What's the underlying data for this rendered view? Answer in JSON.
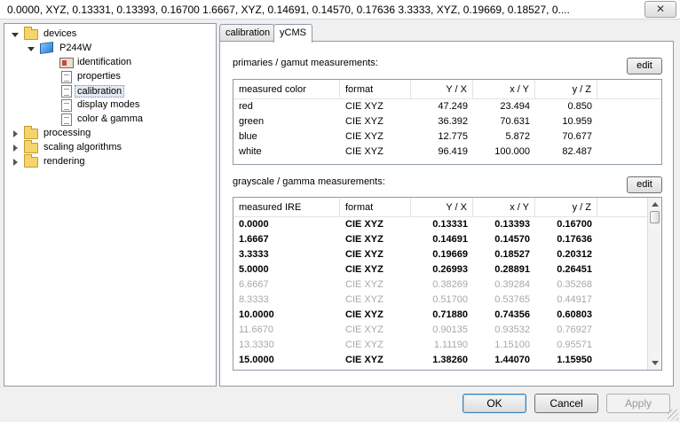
{
  "window": {
    "title": "0.0000, XYZ,  0.13331,    0.13393,  0.16700  1.6667, XYZ,  0.14691,    0.14570,  0.17636  3.3333, XYZ,  0.19669,   0.18527,  0....",
    "close_glyph": "✕"
  },
  "tree": {
    "items": [
      {
        "label": "devices",
        "icon": "folder-icon",
        "expanded": true
      },
      {
        "label": "P244W",
        "icon": "monitor-icon",
        "expanded": true
      },
      {
        "label": "identification",
        "icon": "id-card-icon"
      },
      {
        "label": "properties",
        "icon": "document-icon"
      },
      {
        "label": "calibration",
        "icon": "document-icon",
        "selected": true
      },
      {
        "label": "display modes",
        "icon": "document-icon"
      },
      {
        "label": "color & gamma",
        "icon": "document-icon"
      },
      {
        "label": "processing",
        "icon": "folder-icon",
        "expanded": false
      },
      {
        "label": "scaling algorithms",
        "icon": "folder-icon",
        "expanded": false
      },
      {
        "label": "rendering",
        "icon": "folder-icon",
        "expanded": false
      }
    ]
  },
  "tabs": [
    {
      "label": "calibration",
      "active": false
    },
    {
      "label": "yCMS",
      "active": true
    }
  ],
  "primaries": {
    "title": "primaries / gamut measurements:",
    "edit_label": "edit",
    "columns": [
      "measured color",
      "format",
      "Y / X",
      "x / Y",
      "y / Z"
    ],
    "rows": [
      {
        "c0": "red",
        "c1": "CIE XYZ",
        "c2": "47.249",
        "c3": "23.494",
        "c4": "0.850"
      },
      {
        "c0": "green",
        "c1": "CIE XYZ",
        "c2": "36.392",
        "c3": "70.631",
        "c4": "10.959"
      },
      {
        "c0": "blue",
        "c1": "CIE XYZ",
        "c2": "12.775",
        "c3": "5.872",
        "c4": "70.677"
      },
      {
        "c0": "white",
        "c1": "CIE XYZ",
        "c2": "96.419",
        "c3": "100.000",
        "c4": "82.487"
      }
    ]
  },
  "grayscale": {
    "title": "grayscale / gamma measurements:",
    "edit_label": "edit",
    "columns": [
      "measured IRE",
      "format",
      "Y / X",
      "x / Y",
      "y / Z"
    ],
    "rows": [
      {
        "c0": "0.0000",
        "c1": "CIE XYZ",
        "c2": "0.13331",
        "c3": "0.13393",
        "c4": "0.16700",
        "style": "bold"
      },
      {
        "c0": "1.6667",
        "c1": "CIE XYZ",
        "c2": "0.14691",
        "c3": "0.14570",
        "c4": "0.17636",
        "style": "bold"
      },
      {
        "c0": "3.3333",
        "c1": "CIE XYZ",
        "c2": "0.19669",
        "c3": "0.18527",
        "c4": "0.20312",
        "style": "bold"
      },
      {
        "c0": "5.0000",
        "c1": "CIE XYZ",
        "c2": "0.26993",
        "c3": "0.28891",
        "c4": "0.26451",
        "style": "bold"
      },
      {
        "c0": "6.6667",
        "c1": "CIE XYZ",
        "c2": "0.38269",
        "c3": "0.39284",
        "c4": "0.35268",
        "style": "gray"
      },
      {
        "c0": "8.3333",
        "c1": "CIE XYZ",
        "c2": "0.51700",
        "c3": "0.53765",
        "c4": "0.44917",
        "style": "gray"
      },
      {
        "c0": "10.0000",
        "c1": "CIE XYZ",
        "c2": "0.71880",
        "c3": "0.74356",
        "c4": "0.60803",
        "style": "bold"
      },
      {
        "c0": "11.6670",
        "c1": "CIE XYZ",
        "c2": "0.90135",
        "c3": "0.93532",
        "c4": "0.76927",
        "style": "gray"
      },
      {
        "c0": "13.3330",
        "c1": "CIE XYZ",
        "c2": "1.11190",
        "c3": "1.15100",
        "c4": "0.95571",
        "style": "gray"
      },
      {
        "c0": "15.0000",
        "c1": "CIE XYZ",
        "c2": "1.38260",
        "c3": "1.44070",
        "c4": "1.15950",
        "style": "bold"
      }
    ]
  },
  "buttons": {
    "ok": "OK",
    "cancel": "Cancel",
    "apply": "Apply"
  }
}
